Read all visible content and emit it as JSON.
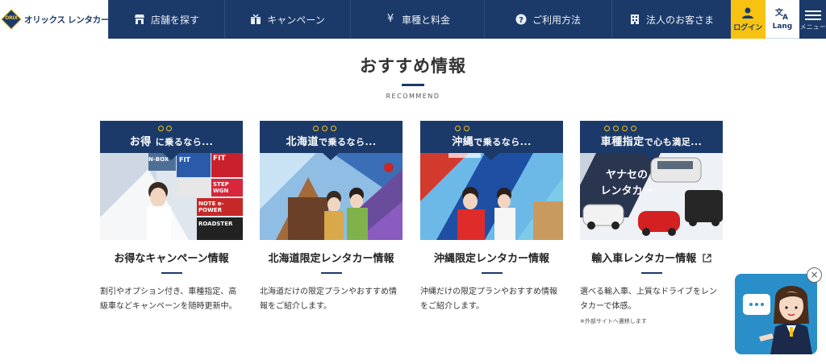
{
  "header": {
    "brand": "オリックス レンタカー",
    "brand_mark": "ORIX",
    "nav": [
      {
        "label": "店舗を探す",
        "icon": "store-icon"
      },
      {
        "label": "キャンペーン",
        "icon": "gift-icon"
      },
      {
        "label": "車種と料金",
        "icon": "yen-icon"
      },
      {
        "label": "ご利用方法",
        "icon": "help-icon"
      },
      {
        "label": "法人のお客さま",
        "icon": "building-icon"
      }
    ],
    "login_label": "ログイン",
    "lang_label": "Lang",
    "menu_label": "メニュー"
  },
  "section": {
    "title": "おすすめ情報",
    "subtitle": "RECOMMEND"
  },
  "cards": [
    {
      "banner_main": "お得",
      "banner_rest": "に乗るなら...",
      "title": "お得なキャンペーン情報",
      "desc": "割引やオプション付き、車種指定、高級車などキャンペーンを随時更新中。"
    },
    {
      "banner_main": "北海道",
      "banner_rest": "で乗るなら...",
      "title": "北海道限定レンタカー情報",
      "desc": "北海道だけの限定プランやおすすめ情報をご紹介します。"
    },
    {
      "banner_main": "沖縄",
      "banner_rest": "で乗るなら...",
      "title": "沖縄限定レンタカー情報",
      "desc": "沖縄だけの限定プランやおすすめ情報をご紹介します。"
    },
    {
      "banner_main": "車種指定",
      "banner_rest": "で心も満足...",
      "title": "輸入車レンタカー情報",
      "desc": "選べる輸入車、上質なドライブをレンタカーで体感。",
      "note": "※外部サイトへ遷移します",
      "image_text": [
        "ヤナセの",
        "レンタカー"
      ]
    }
  ],
  "promo_tiles": [
    "N-BOX",
    "FIT",
    "FIT",
    "STEP WGN",
    "NOTE e-POWER",
    "ROADSTER"
  ],
  "colors": {
    "navy": "#1b3a69",
    "accent_yellow": "#f7c211",
    "chat_blue": "#2a8fc9"
  }
}
